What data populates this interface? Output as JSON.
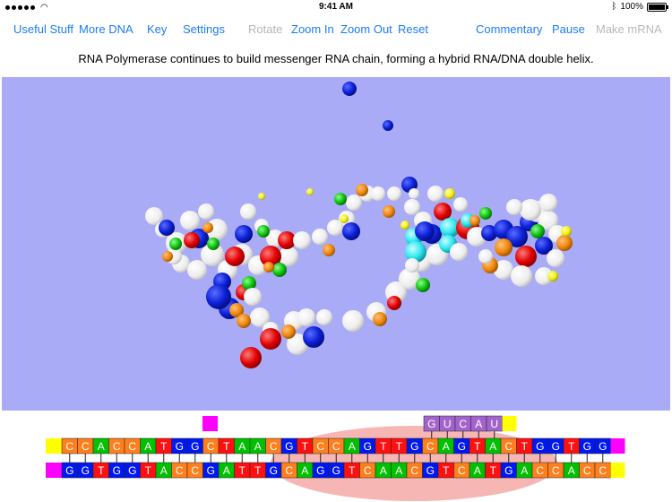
{
  "status": {
    "time": "9:41 AM",
    "battery": "100%",
    "battery_level": 1.0,
    "wifi_icon": "wifi-icon",
    "bluetooth_icon": "bluetooth-icon"
  },
  "toolbar": {
    "useful_stuff": "Useful Stuff",
    "more_dna": "More DNA",
    "key": "Key",
    "settings": "Settings",
    "rotate": "Rotate",
    "zoom_in": "Zoom In",
    "zoom_out": "Zoom Out",
    "reset": "Reset",
    "commentary": "Commentary",
    "pause": "Pause",
    "make_mrna": "Make mRNA"
  },
  "caption": "RNA Polymerase continues to build messenger RNA chain, forming a hybrid RNA/DNA double helix.",
  "colors": {
    "accent": "#1a7cf5",
    "disabled": "#b7b7b7",
    "scene_bg": "#aaabf6",
    "C": "#ff7f1c",
    "A": "#00c000",
    "G": "#0018f0",
    "T": "#ff1010",
    "U": "#a264cc",
    "cap": "#ffff00",
    "end": "#ff00ff",
    "bubble": "#f5a9a7"
  },
  "sequence": {
    "top_strand": "CCACCATGGCTAACGTCCAGTTGCAGTACTGGTGG",
    "bottom_strand": "GGTGGTACCGATTGCAGGTCAACGTCATGACCACC",
    "mrna": "GUCAU"
  }
}
